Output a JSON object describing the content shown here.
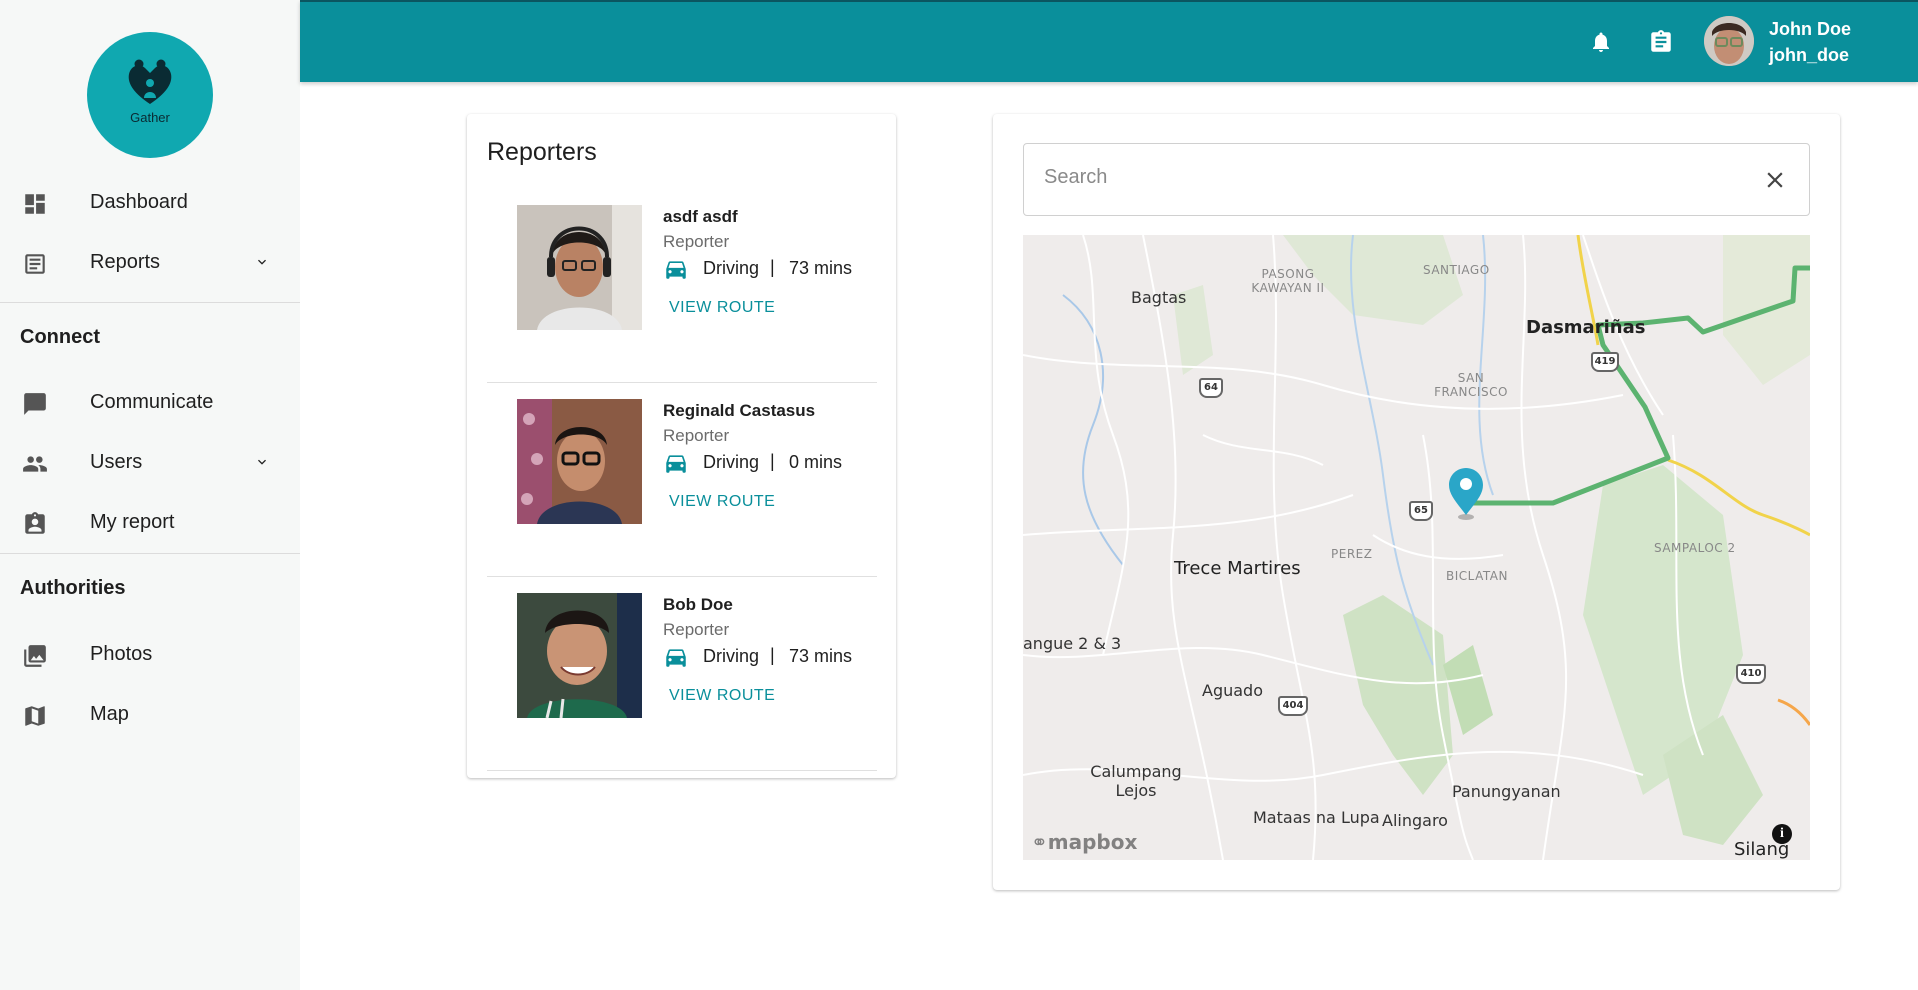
{
  "app": {
    "logo_text": "Gather"
  },
  "sidebar": {
    "items": [
      {
        "label": "Dashboard",
        "icon": "dashboard-icon"
      },
      {
        "label": "Reports",
        "icon": "reports-icon",
        "expandable": true
      },
      {
        "label": "Communicate",
        "icon": "chat-icon"
      },
      {
        "label": "Users",
        "icon": "users-icon",
        "expandable": true
      },
      {
        "label": "My report",
        "icon": "badge-icon"
      },
      {
        "label": "Photos",
        "icon": "photos-icon"
      },
      {
        "label": "Map",
        "icon": "map-icon"
      }
    ],
    "sections": {
      "connect": "Connect",
      "authorities": "Authorities"
    }
  },
  "topbar": {
    "user": {
      "name": "John Doe",
      "handle": "john_doe"
    },
    "icons": [
      "bell-icon",
      "clipboard-icon"
    ]
  },
  "reporters": {
    "title": "Reporters",
    "list": [
      {
        "name": "asdf asdf",
        "role": "Reporter",
        "mode": "Driving",
        "separator": "|",
        "time": "73 mins",
        "action": "VIEW ROUTE"
      },
      {
        "name": "Reginald Castasus",
        "role": "Reporter",
        "mode": "Driving",
        "separator": "|",
        "time": "0 mins",
        "action": "VIEW ROUTE"
      },
      {
        "name": "Bob Doe",
        "role": "Reporter",
        "mode": "Driving",
        "separator": "|",
        "time": "73 mins",
        "action": "VIEW ROUTE"
      }
    ]
  },
  "map": {
    "search_placeholder": "Search",
    "attribution": "mapbox",
    "info": "i",
    "route_color": "#5cb370",
    "accent": "#0a8f9b",
    "labels": {
      "bagtas": "Bagtas",
      "pasong_kawayan": "PASONG KAWAYAN II",
      "santiago": "SANTIAGO",
      "dasmarinas": "Dasmariñas",
      "san_francisco": "SAN FRANCISCO",
      "trece_martires": "Trece Martires",
      "perez": "PEREZ",
      "biclatan": "BICLATAN",
      "sampaloc": "SAMPALOC 2",
      "hugue": "angue 2 & 3",
      "aguado": "Aguado",
      "calumpang": "Calumpang Lejos",
      "panungyanan": "Panungyanan",
      "mataas": "Mataas na Lupa",
      "alingaro": "Alingaro",
      "silang": "Silang"
    },
    "shields": {
      "s64": "64",
      "s65": "65",
      "s419": "419",
      "s404": "404",
      "s410": "410"
    }
  }
}
